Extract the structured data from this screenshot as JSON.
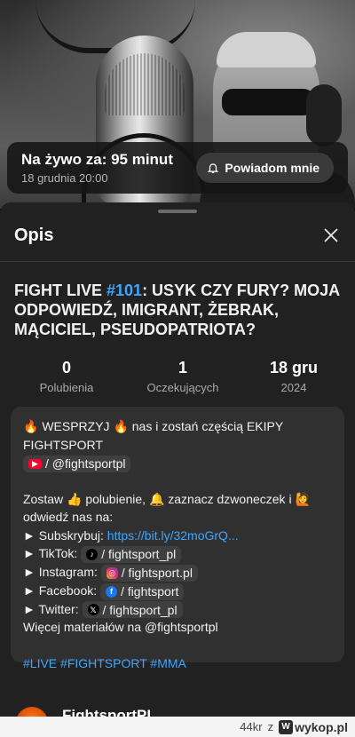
{
  "live": {
    "title": "Na żywo za: 95 minut",
    "date": "18 grudnia 20:00",
    "notify_label": "Powiadom mnie"
  },
  "sheet": {
    "title": "Opis"
  },
  "video": {
    "title_prefix": "FIGHT LIVE ",
    "title_hashtag": "#101",
    "title_rest": ": USYK CZY FURY? MOJA ODPOWIEDŹ, IMIGRANT, ŻEBRAK, MĄCICIEL, PSEUDOPATRIOTA?"
  },
  "stats": [
    {
      "value": "0",
      "label": "Polubienia"
    },
    {
      "value": "1",
      "label": "Oczekujących"
    },
    {
      "value": "18 gru",
      "label": "2024"
    }
  ],
  "description": {
    "line1": "🔥 WESPRZYJ 🔥 nas i zostań częścią EKIPY",
    "line2": "FIGHTSPORT",
    "youtube_chip": "/ @fightsportpl",
    "line3": "Zostaw 👍 polubienie, 🔔 zaznacz dzwoneczek i 🙋",
    "line4": "odwiedź nas na:",
    "subscribe_prefix": "► Subskrybuj: ",
    "subscribe_link": "https://bit.ly/32moGrQ...",
    "tiktok_prefix": "► TikTok: ",
    "tiktok_chip": "/ fightsport_pl",
    "instagram_prefix": "► Instagram: ",
    "instagram_chip": "/ fightsport.pl",
    "facebook_prefix": "► Facebook: ",
    "facebook_chip": "/ fightsport",
    "twitter_prefix": "► Twitter: ",
    "twitter_chip": "/ fightsport_pl",
    "more": "Więcej materiałów na @fightsportpl",
    "tags": "#LIVE #FIGHTSPORT #MMA"
  },
  "channel": {
    "name": "FightsportPL"
  },
  "watermark": {
    "user": "44kr",
    "sep": "z",
    "site": "wykop.pl"
  },
  "icons": {
    "bell": "bell-icon",
    "close": "close-icon",
    "youtube": "youtube-icon",
    "tiktok": "tiktok-icon",
    "instagram": "instagram-icon",
    "facebook": "facebook-icon",
    "twitter": "x-icon"
  },
  "colors": {
    "accent_link": "#3ea6ff",
    "sheet_bg": "#212121",
    "desc_bg": "#303030"
  }
}
